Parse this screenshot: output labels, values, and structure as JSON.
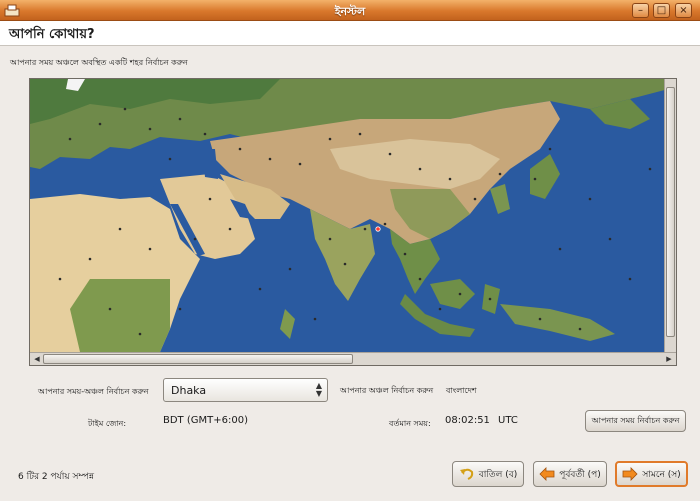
{
  "window": {
    "title": "ইনস্টল",
    "min_label": "–",
    "max_label": "□",
    "close_label": "×"
  },
  "page": {
    "title": "আপনি কোথায়?",
    "instruction": "আপনার সময় অঞ্চলে অবস্থিত একটি শহর নির্বাচন করুন"
  },
  "map": {
    "scroll_left": "◀",
    "scroll_right": "▶"
  },
  "timezone": {
    "label": "আপনার সময়-অঞ্চল নির্বাচন করুন",
    "selected": "Dhaka",
    "region_label": "আপনার অঞ্চল নির্বাচন করুন",
    "region_value": "বাংলাদেশ",
    "zone_label": "টাইম জোন:",
    "zone_value": "BDT (GMT+6:00)",
    "time_label": "বর্তমান সময়:",
    "time_value": "08:02:51",
    "time_suffix": "UTC",
    "set_time_button": "আপনার সময় নির্বাচন করুন"
  },
  "footer": {
    "step": "6 টির 2 পর্যায় সম্পন্ন",
    "cancel": "বাতিল (ব)",
    "back": "পূর্ববর্তী (প)",
    "forward": "সামনে (স)"
  },
  "colors": {
    "titlebar": "#d9782c",
    "ocean": "#2a5aa0",
    "accent": "#e07a2a"
  }
}
